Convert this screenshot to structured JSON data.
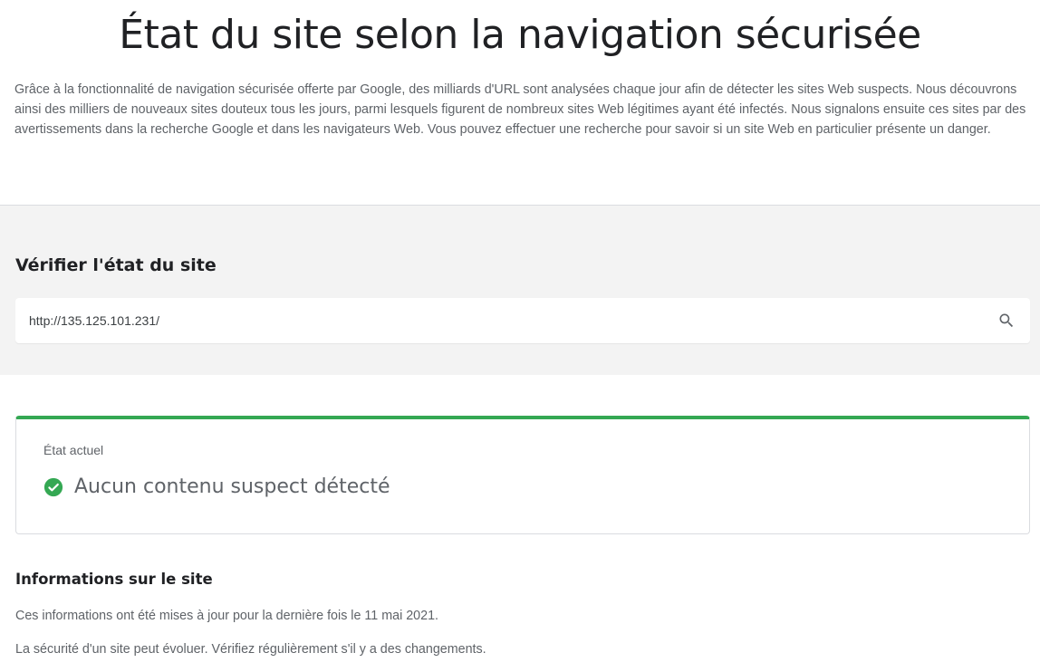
{
  "header": {
    "title": "État du site selon la navigation sécurisée",
    "intro": "Grâce à la fonctionnalité de navigation sécurisée offerte par Google, des milliards d'URL sont analysées chaque jour afin de détecter les sites Web suspects. Nous découvrons ainsi des milliers de nouveaux sites douteux tous les jours, parmi lesquels figurent de nombreux sites Web légitimes ayant été infectés. Nous signalons ensuite ces sites par des avertissements dans la recherche Google et dans les navigateurs Web. Vous pouvez effectuer une recherche pour savoir si un site Web en particulier présente un danger."
  },
  "check": {
    "title": "Vérifier l'état du site",
    "search_value": "http://135.125.101.231/",
    "search_icon": "search-icon"
  },
  "status": {
    "label": "État actuel",
    "result": "Aucun contenu suspect détecté",
    "icon": "check-circle-icon",
    "accent_color": "#34a853"
  },
  "info": {
    "title": "Informations sur le site",
    "updated": "Ces informations ont été mises à jour pour la dernière fois le 11 mai 2021.",
    "note": "La sécurité d'un site peut évoluer. Vérifiez régulièrement s'il y a des changements."
  }
}
